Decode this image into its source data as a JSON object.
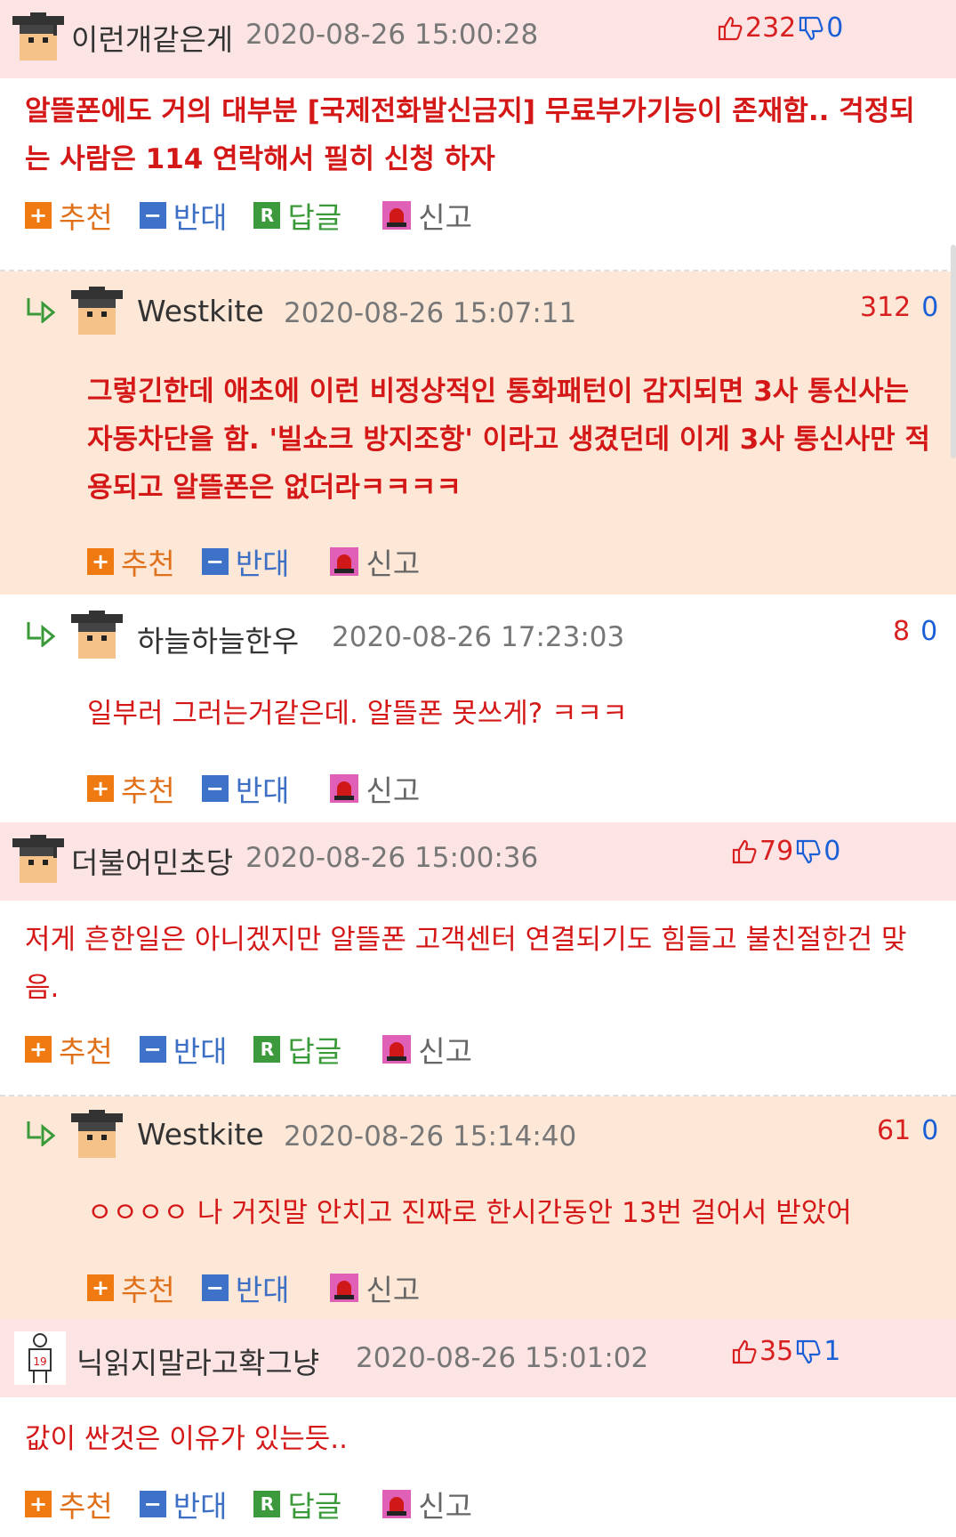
{
  "actions": {
    "recommend": "추천",
    "oppose": "반대",
    "reply": "답글",
    "report": "신고"
  },
  "colors": {
    "head_bg": "#fce4e4",
    "reply_bg": "#fde8d8",
    "comment_text": "#d41818",
    "recommend": "#f07a12",
    "oppose": "#3d72c8",
    "reply_icon": "#3c9a3c"
  },
  "comments": [
    {
      "nick": "이런개같은게",
      "date": "2020-08-26 15:00:28",
      "up": "232",
      "down": "0",
      "text": "알뜰폰에도 거의 대부분 [국제전화발신금지] 무료부가기능이 존재함.. 걱정되는 사람은 114 연락해서 필히 신청 하자"
    },
    {
      "nick": "Westkite",
      "date": "2020-08-26 15:07:11",
      "up": "312",
      "down": "0",
      "text": "그렇긴한데 애초에 이런 비정상적인 통화패턴이 감지되면 3사 통신사는 자동차단을 함. '빌쇼크 방지조항' 이라고 생겼던데 이게 3사 통신사만 적용되고 알뜰폰은 없더라ㅋㅋㅋㅋ"
    },
    {
      "nick": "하늘하늘한우",
      "date": "2020-08-26 17:23:03",
      "up": "8",
      "down": "0",
      "text": "일부러 그러는거같은데. 알뜰폰 못쓰게? ㅋㅋㅋ"
    },
    {
      "nick": "더불어민초당",
      "date": "2020-08-26 15:00:36",
      "up": "79",
      "down": "0",
      "text": "저게 흔한일은 아니겠지만 알뜰폰 고객센터 연결되기도 힘들고 불친절한건 맞음."
    },
    {
      "nick": "Westkite",
      "date": "2020-08-26 15:14:40",
      "up": "61",
      "down": "0",
      "text": "ㅇㅇㅇㅇ 나 거짓말 안치고 진짜로 한시간동안 13번 걸어서 받았어"
    },
    {
      "nick": "닉읽지말라고확그냥",
      "date": "2020-08-26 15:01:02",
      "up": "35",
      "down": "1",
      "text": "값이 싼것은 이유가 있는듯.."
    }
  ]
}
